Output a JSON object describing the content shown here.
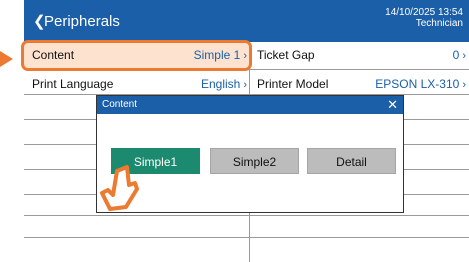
{
  "header": {
    "back_glyph": "❮",
    "title": "Peripherals",
    "datetime": "14/10/2025  13:54",
    "user": "Technician"
  },
  "rows": [
    {
      "left_label": "Content",
      "left_value": "Simple 1",
      "right_label": "Ticket Gap",
      "right_value": "0"
    },
    {
      "left_label": "Print Language",
      "left_value": "English",
      "right_label": "Printer Model",
      "right_value": "EPSON LX-310"
    }
  ],
  "chevron": "›",
  "dialog": {
    "title": "Content",
    "close_glyph": "✕",
    "options": [
      {
        "label": "Simple1",
        "selected": true
      },
      {
        "label": "Simple2",
        "selected": false
      },
      {
        "label": "Detail",
        "selected": false
      }
    ]
  },
  "colors": {
    "header_blue": "#1b5fa8",
    "highlight_orange": "#ec7a30",
    "highlight_fill": "#fde3cf",
    "selected_green": "#1c8a6e",
    "option_gray": "#bcbcbc"
  },
  "icons": {
    "back": "chevron-left-icon",
    "close": "close-icon",
    "pointer": "pointer-arrow-icon",
    "hand": "hand-cursor-icon"
  }
}
